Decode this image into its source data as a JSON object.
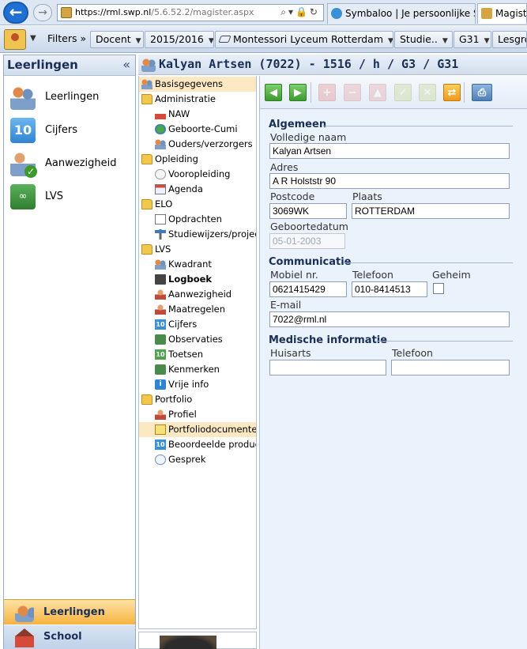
{
  "browser": {
    "url_host": "https://rml.swp.nl",
    "url_path": "/5.6.52.2/magister.aspx",
    "tabs": [
      {
        "label": "Symbaloo | Je persoonlijke St..."
      },
      {
        "label": "Magiste"
      }
    ]
  },
  "toolbar": {
    "filters_label": "Filters »",
    "docent": "Docent",
    "year": "2015/2016",
    "school": "Montessori Lyceum Rotterdam",
    "studie": "Studie..",
    "group": "G31",
    "lesgroep": "Lesgro"
  },
  "sidebar": {
    "title": "Leerlingen",
    "collapse_glyph": "«",
    "items": [
      {
        "label": "Leerlingen",
        "icon": "people-icon"
      },
      {
        "label": "Cijfers",
        "icon": "grades-10-icon",
        "glyph": "10"
      },
      {
        "label": "Aanwezigheid",
        "icon": "attendance-check-icon"
      },
      {
        "label": "LVS",
        "icon": "binoculars-icon"
      }
    ],
    "bottom_active": "Leerlingen",
    "bottom": "School"
  },
  "title_bar": {
    "text": "Kalyan Artsen (7022) - 1516 / h / G3 / G31"
  },
  "tree": [
    {
      "label": "Basisgegevens",
      "kind": "top",
      "icon": "people",
      "selected": true
    },
    {
      "label": "Administratie",
      "kind": "top",
      "icon": "folder"
    },
    {
      "label": "NAW",
      "kind": "child",
      "icon": "house"
    },
    {
      "label": "Geboorte-Cumi",
      "kind": "child",
      "icon": "globe"
    },
    {
      "label": "Ouders/verzorgers",
      "kind": "child",
      "icon": "people"
    },
    {
      "label": "Opleiding",
      "kind": "top",
      "icon": "folder"
    },
    {
      "label": "Vooropleiding",
      "kind": "child",
      "icon": "hat"
    },
    {
      "label": "Agenda",
      "kind": "child",
      "icon": "calendar"
    },
    {
      "label": "ELO",
      "kind": "top",
      "icon": "folder"
    },
    {
      "label": "Opdrachten",
      "kind": "child",
      "icon": "doc"
    },
    {
      "label": "Studiewijzers/projecten",
      "kind": "child",
      "icon": "sign"
    },
    {
      "label": "LVS",
      "kind": "top",
      "icon": "folder"
    },
    {
      "label": "Kwadrant",
      "kind": "child",
      "icon": "people"
    },
    {
      "label": "Logboek",
      "kind": "child",
      "icon": "book",
      "bold": true
    },
    {
      "label": "Aanwezigheid",
      "kind": "child",
      "icon": "person"
    },
    {
      "label": "Maatregelen",
      "kind": "child",
      "icon": "person"
    },
    {
      "label": "Cijfers",
      "kind": "child",
      "icon": "ten"
    },
    {
      "label": "Observaties",
      "kind": "child",
      "icon": "binoc"
    },
    {
      "label": "Toetsen",
      "kind": "child",
      "icon": "tengreen"
    },
    {
      "label": "Kenmerken",
      "kind": "child",
      "icon": "binoc"
    },
    {
      "label": "Vrije info",
      "kind": "child",
      "icon": "info"
    },
    {
      "label": "Portfolio",
      "kind": "top",
      "icon": "folder"
    },
    {
      "label": "Profiel",
      "kind": "child",
      "icon": "person"
    },
    {
      "label": "Portfoliodocumenten",
      "kind": "child",
      "icon": "docyellow",
      "highlight": true
    },
    {
      "label": "Beoordeelde producten",
      "kind": "child",
      "icon": "ten"
    },
    {
      "label": "Gesprek",
      "kind": "child",
      "icon": "bubble"
    }
  ],
  "actions": [
    {
      "name": "previous-button",
      "glyph": "◀",
      "style": "green"
    },
    {
      "name": "next-button",
      "glyph": "▶",
      "style": "green"
    },
    {
      "name": "add-button",
      "glyph": "+",
      "style": "red dim"
    },
    {
      "name": "remove-button",
      "glyph": "−",
      "style": "rose dim"
    },
    {
      "name": "up-button",
      "glyph": "▲",
      "style": "rose dim"
    },
    {
      "name": "confirm-button",
      "glyph": "✓",
      "style": "olive dim"
    },
    {
      "name": "cancel-button",
      "glyph": "✕",
      "style": "olive dim"
    },
    {
      "name": "refresh-button",
      "glyph": "⇄",
      "style": "orange"
    },
    {
      "name": "print-button",
      "glyph": "⎙",
      "style": "print"
    }
  ],
  "form": {
    "algemeen": {
      "title": "Algemeen",
      "volledige_naam_label": "Volledige naam",
      "volledige_naam": "Kalyan Artsen",
      "adres_label": "Adres",
      "adres": "A R Holststr 90",
      "postcode_label": "Postcode",
      "postcode": "3069WK",
      "plaats_label": "Plaats",
      "plaats": "ROTTERDAM",
      "geboortedatum_label": "Geboortedatum",
      "geboortedatum": "05-01-2003"
    },
    "communicatie": {
      "title": "Communicatie",
      "mobiel_label": "Mobiel nr.",
      "mobiel": "0621415429",
      "telefoon_label": "Telefoon",
      "telefoon": "010-8414513",
      "geheim_label": "Geheim",
      "email_label": "E-mail",
      "email": "7022@rml.nl"
    },
    "medisch": {
      "title": "Medische informatie",
      "huisarts_label": "Huisarts",
      "huisarts": "",
      "telefoon_label": "Telefoon",
      "telefoon": ""
    }
  }
}
